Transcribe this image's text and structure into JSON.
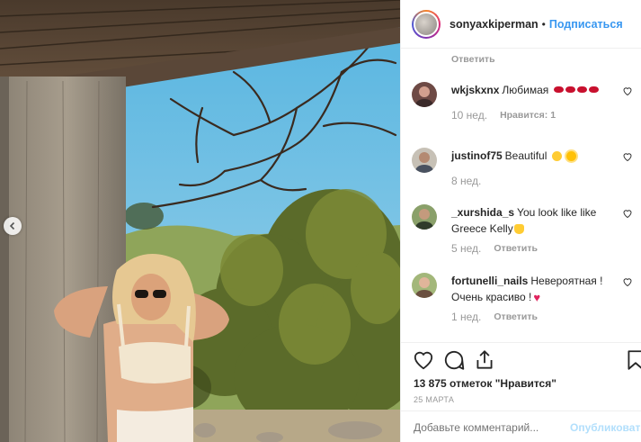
{
  "post": {
    "username": "sonyaxkiperman",
    "dot": "•",
    "follow_label": "Подписаться"
  },
  "top_reply_label": "Ответить",
  "comments": [
    {
      "user": "wkjskxnx",
      "text": "Любимая",
      "emoji": "lips-x4",
      "time": "10 нед.",
      "likes_text": "Нравится: 1",
      "reply_label": ""
    },
    {
      "user": "justinof75",
      "text": "Beautiful",
      "emoji": "smile-sun",
      "time": "8 нед.",
      "likes_text": "",
      "reply_label": ""
    },
    {
      "user": "_xurshida_s",
      "text": "You look like like",
      "text2": "Greece Kelly",
      "emoji": "thumbs-up",
      "time": "5 нед.",
      "likes_text": "",
      "reply_label": "Ответить"
    },
    {
      "user": "fortunelli_nails",
      "text": "Невероятная !",
      "text2": "Очень красиво !",
      "emoji": "red-heart",
      "time": "1 нед.",
      "likes_text": "",
      "reply_label": "Ответить"
    }
  ],
  "footer": {
    "likes": "13 875 отметок \"Нравится\"",
    "date": "25 МАРТА",
    "comment_placeholder": "Добавьте комментарий...",
    "post_label": "Опубликовать"
  },
  "icons": {
    "like": "heart-outline-icon",
    "comment": "comment-bubble-icon",
    "share": "share-icon",
    "save": "bookmark-icon",
    "prev": "chevron-left-icon"
  },
  "colors": {
    "link_blue": "#3897f0",
    "muted": "#999999",
    "post_disabled": "#b2dffc"
  }
}
